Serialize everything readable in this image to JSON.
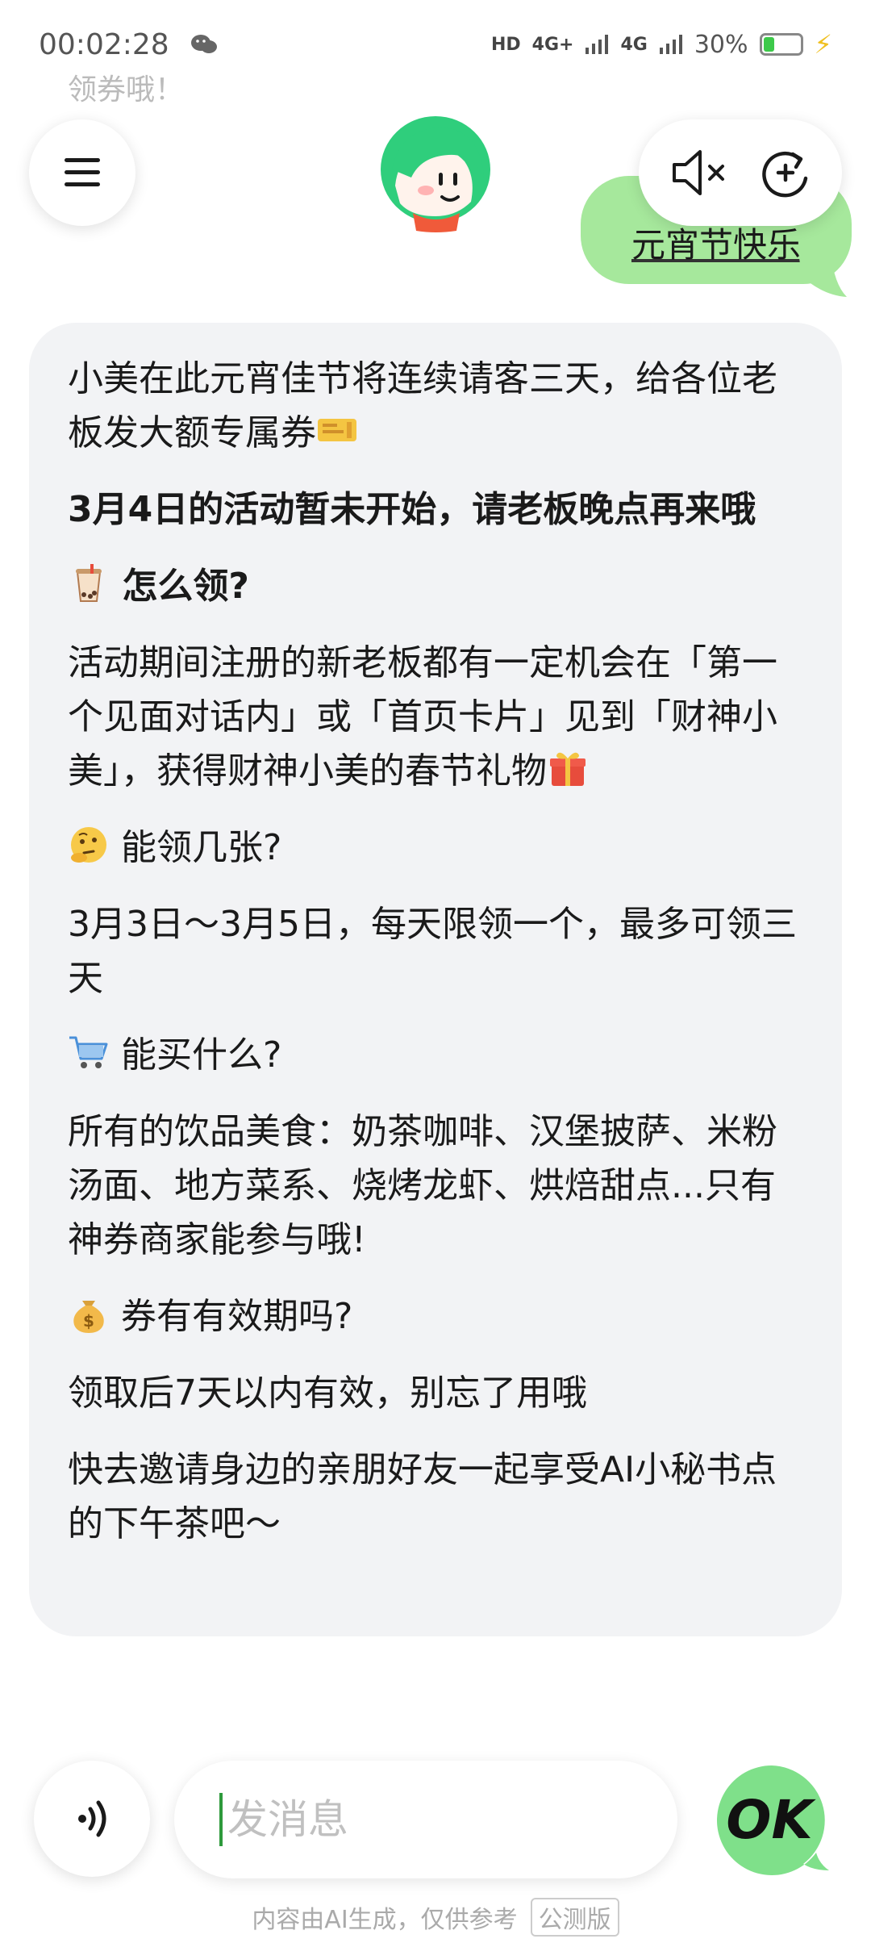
{
  "status_bar": {
    "time": "00:02:28",
    "hd": "HD",
    "sig1": "4G+",
    "sig2": "4G",
    "battery": "30%",
    "battery_level": 0.3
  },
  "faded_top_text": "领券哦！",
  "user_message": "元宵节快乐",
  "bot_message": {
    "p1": "小美在此元宵佳节将连续请客三天，给各位老板发大额专属券",
    "p2": "3月4日的活动暂未开始，请老板晚点再来哦",
    "h1": "怎么领?",
    "p3": "活动期间注册的新老板都有一定机会在「第一个见面对话内」或「首页卡片」见到「财神小美」，获得财神小美的春节礼物",
    "h2": "能领几张?",
    "p4": "3月3日～3月5日，每天限领一个，最多可领三天",
    "h3": "能买什么?",
    "p5": "所有的饮品美食：奶茶咖啡、汉堡披萨、米粉汤面、地方菜系、烧烤龙虾、烘焙甜点...只有神券商家能参与哦!",
    "h4": "券有有效期吗?",
    "p6": "领取后7天以内有效，别忘了用哦",
    "p7": "快去邀请身边的亲朋好友一起享受AI小秘书点的下午茶吧～"
  },
  "input": {
    "placeholder": "发消息"
  },
  "ok_label": "OK",
  "footer": {
    "note": "内容由AI生成，仅供参考",
    "tag": "公测版"
  },
  "icons": {
    "menu": "menu-icon",
    "mute": "speaker-mute-icon",
    "refresh": "new-chat-icon",
    "voice": "voice-icon",
    "ticket": "ticket-emoji",
    "bubble_tea": "bubble-tea-emoji",
    "gift": "gift-emoji",
    "thinking": "thinking-emoji",
    "cart": "cart-emoji",
    "money_bag": "money-bag-emoji"
  },
  "colors": {
    "accent_green": "#a6e89c",
    "ok_green": "#7fe08a",
    "bubble_bg": "#f2f3f5"
  }
}
